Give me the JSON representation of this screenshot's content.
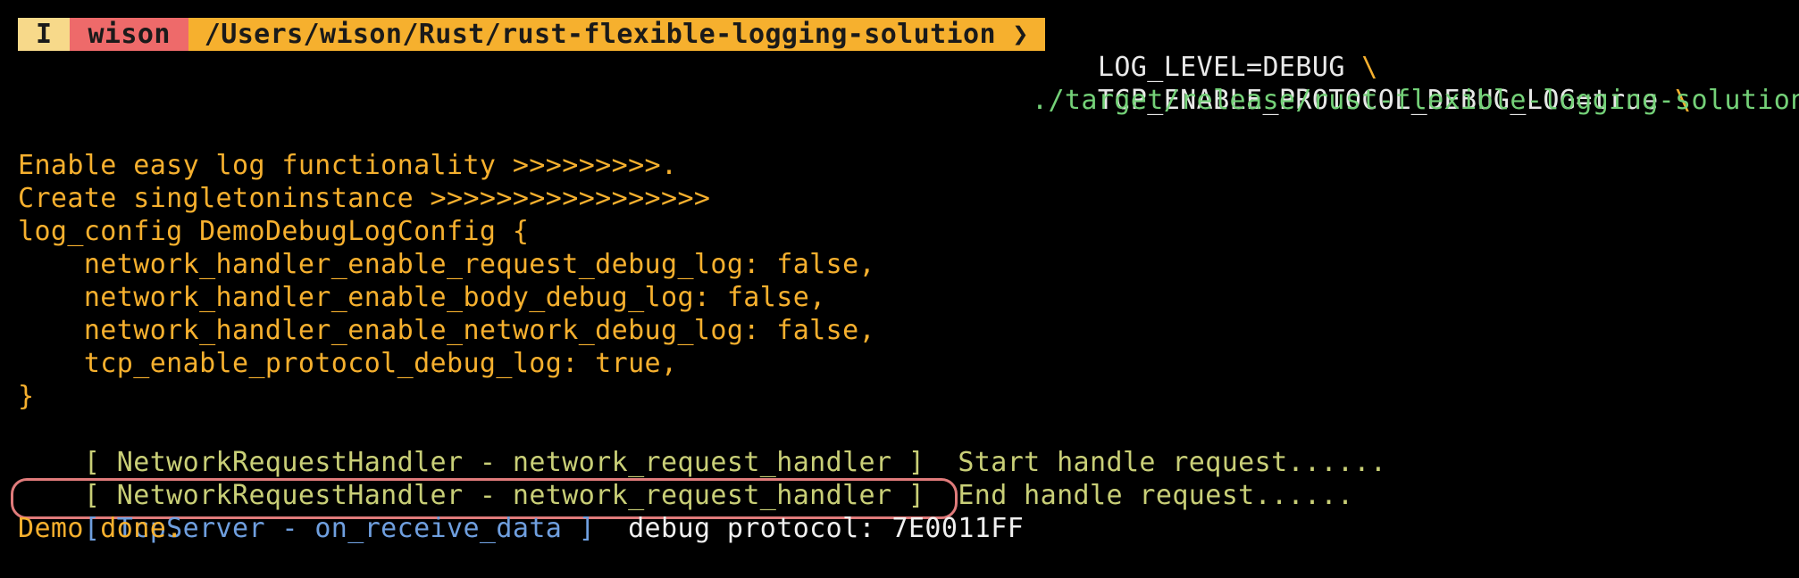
{
  "prompt": {
    "mode": "I",
    "user": "wison",
    "path": "/Users/wison/Rust/rust-flexible-logging-solution ❯"
  },
  "command": {
    "line1_text": "LOG_LEVEL=DEBUG",
    "line1_cont": " \\",
    "line2_text": "TCP_ENABLE_PROTOCOL_DEBUG_LOG=true",
    "line2_cont": " \\",
    "line3_text": "./target/release/rust-flexible-logging-solution"
  },
  "output": {
    "line1": "Enable easy log functionality >>>>>>>>>.",
    "line2": "Create singletoninstance >>>>>>>>>>>>>>>>>",
    "line3": "log_config DemoDebugLogConfig {",
    "line4": "    network_handler_enable_request_debug_log: false,",
    "line5": "    network_handler_enable_body_debug_log: false,",
    "line6": "    network_handler_enable_network_debug_log: false,",
    "line7": "    tcp_enable_protocol_debug_log: true,",
    "line8": "}",
    "log1_tag": "[ NetworkRequestHandler - network_request_handler ]",
    "log1_msg": "  Start handle request......",
    "log2_tag": "[ NetworkRequestHandler - network_request_handler ]",
    "log2_msg": "  End handle request......",
    "tcp_tag": "[ TcpServer - on_receive_data ]",
    "tcp_msg": "  debug protocol: 7E0011FF",
    "done": "Demo done."
  },
  "colors": {
    "background": "#000000",
    "prompt_mode_bg": "#f7d98a",
    "prompt_user_bg": "#ee6a6a",
    "prompt_path_bg": "#f6b02e",
    "output_orange": "#f6b02e",
    "command_green": "#74d178",
    "log_olive": "#c9cf77",
    "tcp_blue": "#6f9fdf",
    "highlight_border": "#e07b7b"
  }
}
